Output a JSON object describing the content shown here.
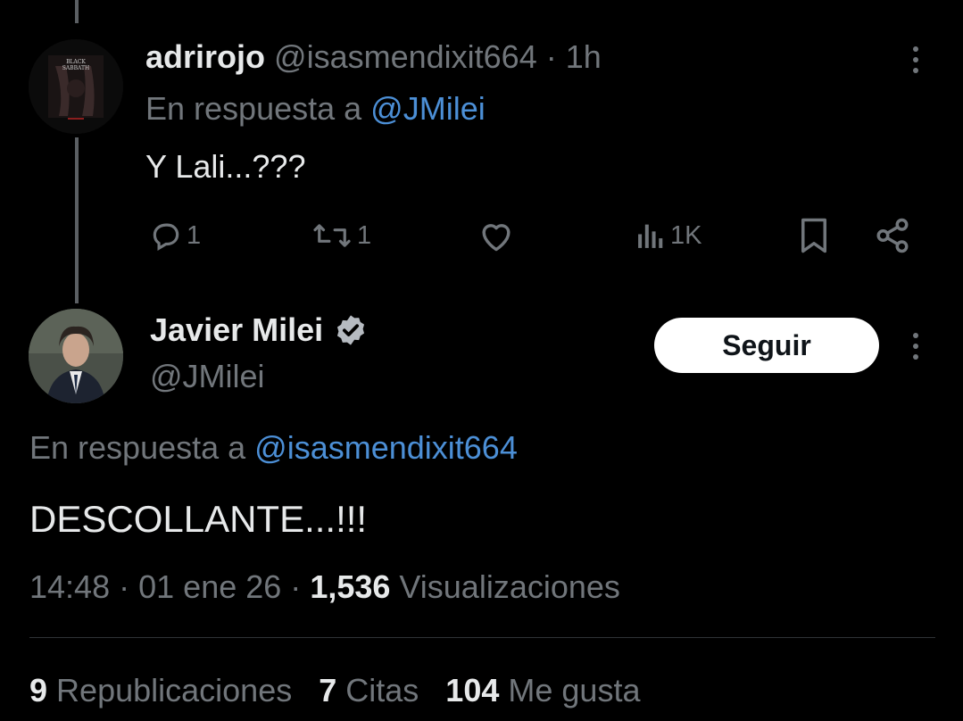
{
  "reply_tweet": {
    "display_name": "adrirojo",
    "handle": "@isasmendixit664",
    "separator": "·",
    "time": "1h",
    "reply_to_prefix": "En respuesta a",
    "reply_to_handle": "@JMilei",
    "text": "Y Lali...???",
    "avatar_text_line1": "BLACK",
    "avatar_text_line2": "SABBATH",
    "actions": {
      "replies": "1",
      "reposts": "1",
      "likes": "",
      "views": "1K"
    },
    "icons": [
      "reply-icon",
      "repost-icon",
      "like-icon",
      "views-icon",
      "bookmark-icon",
      "share-icon",
      "more-icon"
    ]
  },
  "main_tweet": {
    "display_name": "Javier Milei",
    "handle": "@JMilei",
    "follow_label": "Seguir",
    "reply_to_prefix": "En respuesta a",
    "reply_to_handle": "@isasmendixit664",
    "text": "DESCOLLANTE...!!!",
    "time": "14:48",
    "separator": "·",
    "date": "01 ene 26",
    "views_count": "1,536",
    "views_label": "Visualizaciones"
  },
  "stats": {
    "reposts_count": "9",
    "reposts_label": "Republicaciones",
    "quotes_count": "7",
    "quotes_label": "Citas",
    "likes_count": "104",
    "likes_label": "Me gusta"
  },
  "colors": {
    "background": "#000000",
    "text_primary": "#e7e9ea",
    "text_secondary": "#71767b",
    "link": "#4c8fd6",
    "divider": "#2f3336"
  }
}
